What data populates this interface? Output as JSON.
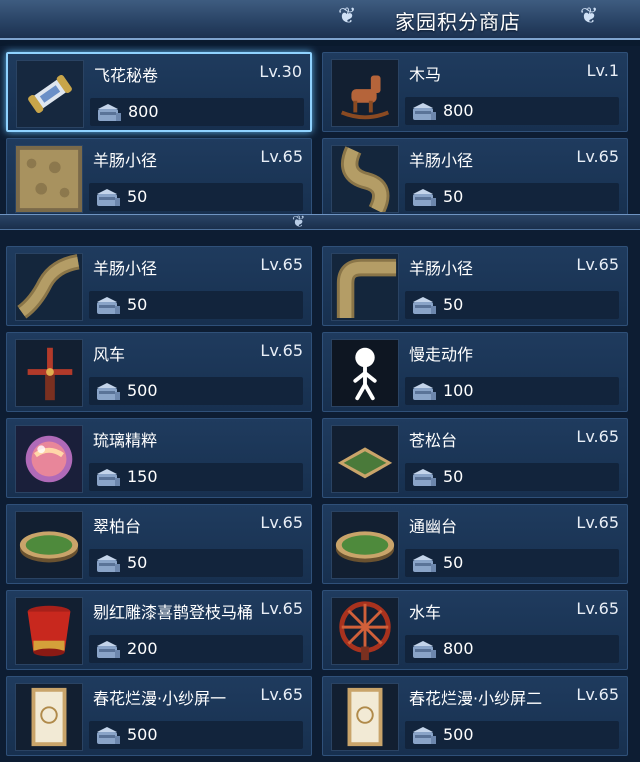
{
  "shop": {
    "title": "家园积分商店",
    "ornament_left": "❦",
    "ornament_right": "❦"
  },
  "items": [
    {
      "name": "飞花秘卷",
      "level": "Lv.30",
      "price": "800",
      "icon": "scroll-icon",
      "selected": true
    },
    {
      "name": "木马",
      "level": "Lv.1",
      "price": "800",
      "icon": "rocking-horse-icon"
    },
    {
      "name": "羊肠小径",
      "level": "Lv.65",
      "price": "50",
      "icon": "stone-path-square-icon"
    },
    {
      "name": "羊肠小径",
      "level": "Lv.65",
      "price": "50",
      "icon": "winding-path-icon"
    },
    {
      "name": "羊肠小径",
      "level": "Lv.65",
      "price": "50",
      "icon": "curved-path-icon"
    },
    {
      "name": "羊肠小径",
      "level": "Lv.65",
      "price": "50",
      "icon": "corner-path-icon"
    },
    {
      "name": "风车",
      "level": "Lv.65",
      "price": "500",
      "icon": "windmill-icon"
    },
    {
      "name": "慢走动作",
      "level": "",
      "price": "100",
      "icon": "stick-figure-icon"
    },
    {
      "name": "琉璃精粹",
      "level": "",
      "price": "150",
      "icon": "glass-orb-icon"
    },
    {
      "name": "苍松台",
      "level": "Lv.65",
      "price": "50",
      "icon": "square-platform-icon"
    },
    {
      "name": "翠柏台",
      "level": "Lv.65",
      "price": "50",
      "icon": "round-platform-icon"
    },
    {
      "name": "通幽台",
      "level": "Lv.65",
      "price": "50",
      "icon": "round-platform-icon"
    },
    {
      "name": "剔红雕漆喜鹊登枝马桶",
      "level": "Lv.65",
      "price": "200",
      "icon": "lacquer-bucket-icon"
    },
    {
      "name": "水车",
      "level": "Lv.65",
      "price": "800",
      "icon": "waterwheel-icon"
    },
    {
      "name": "春花烂漫·小纱屏一",
      "level": "Lv.65",
      "price": "500",
      "icon": "screen-panel-icon"
    },
    {
      "name": "春花烂漫·小纱屏二",
      "level": "Lv.65",
      "price": "500",
      "icon": "screen-panel-icon"
    }
  ]
}
